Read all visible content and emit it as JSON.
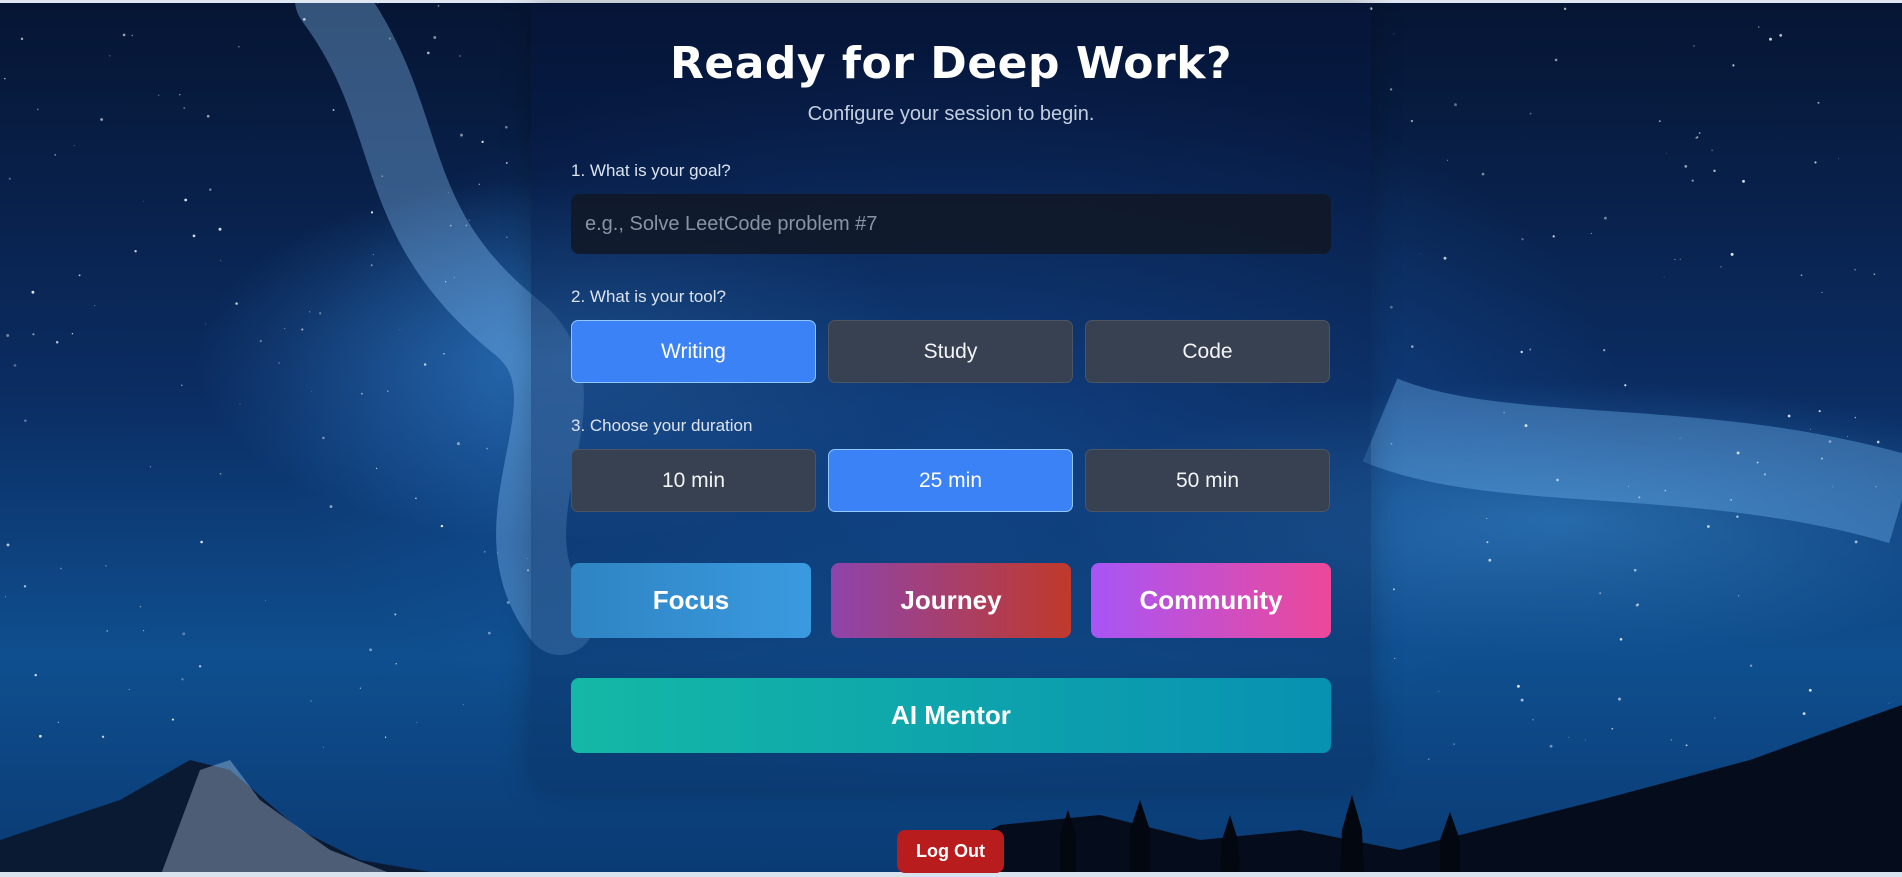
{
  "header": {
    "title": "Ready for Deep Work?",
    "subtitle": "Configure your session to begin."
  },
  "goal": {
    "label": "1. What is your goal?",
    "placeholder": "e.g., Solve LeetCode problem #7",
    "value": ""
  },
  "tool": {
    "label": "2. What is your tool?",
    "options": [
      "Writing",
      "Study",
      "Code"
    ],
    "selected": "Writing"
  },
  "duration": {
    "label": "3. Choose your duration",
    "options": [
      "10 min",
      "25 min",
      "50 min"
    ],
    "selected": "25 min"
  },
  "nav": {
    "focus": "Focus",
    "journey": "Journey",
    "community": "Community",
    "mentor": "AI Mentor"
  },
  "logout": "Log Out",
  "colors": {
    "selected_option": "#3b82f6",
    "unselected_option": "#374151",
    "logout": "#b91c1c",
    "mentor_start": "#14b8a6",
    "mentor_end": "#0891b2"
  }
}
